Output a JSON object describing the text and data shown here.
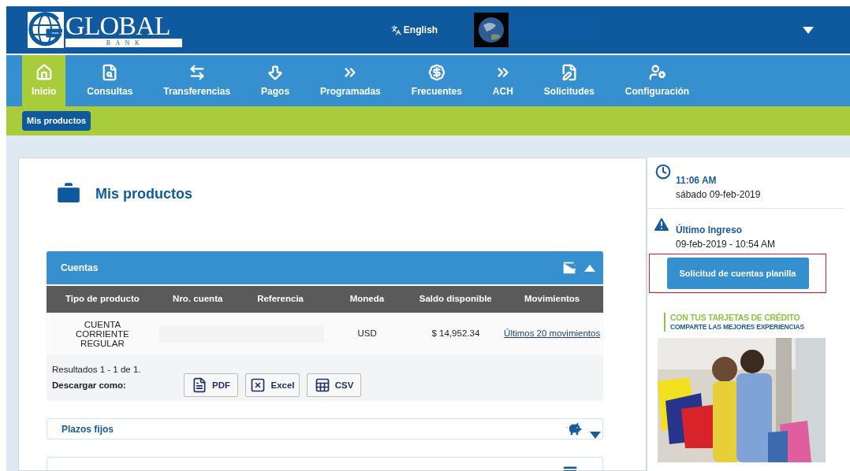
{
  "header": {
    "logo_word": "GLOBAL",
    "logo_subword": "B A N K",
    "language_link": "English"
  },
  "nav": [
    {
      "label": "Inicio",
      "selected": true
    },
    {
      "label": "Consultas",
      "selected": false
    },
    {
      "label": "Transferencias",
      "selected": false
    },
    {
      "label": "Pagos",
      "selected": false
    },
    {
      "label": "Programadas",
      "selected": false
    },
    {
      "label": "Frecuentes",
      "selected": false
    },
    {
      "label": "ACH",
      "selected": false
    },
    {
      "label": "Solicitudes",
      "selected": false
    },
    {
      "label": "Configuración",
      "selected": false
    }
  ],
  "subnav": [
    {
      "label": "Mis productos",
      "selected": true
    }
  ],
  "page_title": "Mis productos",
  "sections": [
    {
      "title": "Cuentas",
      "expanded": true,
      "table": {
        "columns": [
          "Tipo de producto",
          "Nro. cuenta",
          "Referencia",
          "Moneda",
          "Saldo disponible",
          "Movimientos"
        ],
        "rows": [
          {
            "product": "CUENTA CORRIENTE REGULAR",
            "currency": "USD",
            "balance": "$ 14,952.34",
            "link": "Últimos 20 movimientos"
          }
        ]
      },
      "results": "Resultados 1 - 1 de 1.",
      "download_label": "Descargar como:",
      "downloads": [
        "PDF",
        "Excel",
        "CSV"
      ]
    },
    {
      "title": "Plazos fijos",
      "expanded": false
    }
  ],
  "sidebar": {
    "time": "11:06 AM",
    "date": "sábado 09-feb-2019",
    "last_login_label": "Último Ingreso",
    "last_login": "09-feb-2019 - 10:54 AM",
    "action_button": "Solicitud de cuentas planilla",
    "highlighted": true,
    "promo": {
      "line_1": "CON TUS TARJETAS DE CRÉDITO",
      "line_2": "COMPARTE LAS MEJORES EXPERIENCIAS"
    }
  }
}
